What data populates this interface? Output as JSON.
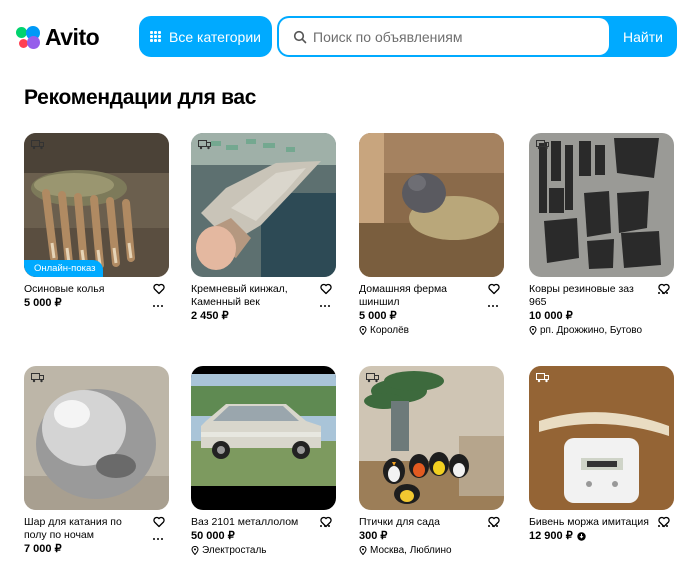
{
  "brand": {
    "name": "Avito"
  },
  "header": {
    "categories_label": "Все категории",
    "search_placeholder": "Поиск по объявлениям",
    "search_button": "Найти"
  },
  "section_title": "Рекомендации для вас",
  "colors": {
    "accent": "#00aaff",
    "logo_green": "#00d36e",
    "logo_blue": "#0099f7",
    "logo_red": "#ff4053",
    "logo_purple": "#965eeb"
  },
  "items": [
    {
      "title": "Осиновые колья",
      "price": "5 000 ₽",
      "location": "",
      "tag": "Онлайн-показ"
    },
    {
      "title": "Кремневый кинжал, Каменный век",
      "price": "2 450 ₽",
      "location": ""
    },
    {
      "title": "Домашняя ферма шиншил",
      "price": "5 000 ₽",
      "location": "Королёв"
    },
    {
      "title": "Ковры резиновые заз 965",
      "price": "10 000 ₽",
      "location": "рп. Дрожжино, Бутово"
    },
    {
      "title": "Шар для катания по полу по ночам",
      "price": "7 000 ₽",
      "location": ""
    },
    {
      "title": "Ваз 2101 металлолом",
      "price": "50 000 ₽",
      "location": "Электросталь"
    },
    {
      "title": "Птички для сада",
      "price": "300 ₽",
      "location": "Москва, Люблино"
    },
    {
      "title": "Бивень моржа имитация",
      "price": "12 900 ₽",
      "location": ""
    }
  ]
}
